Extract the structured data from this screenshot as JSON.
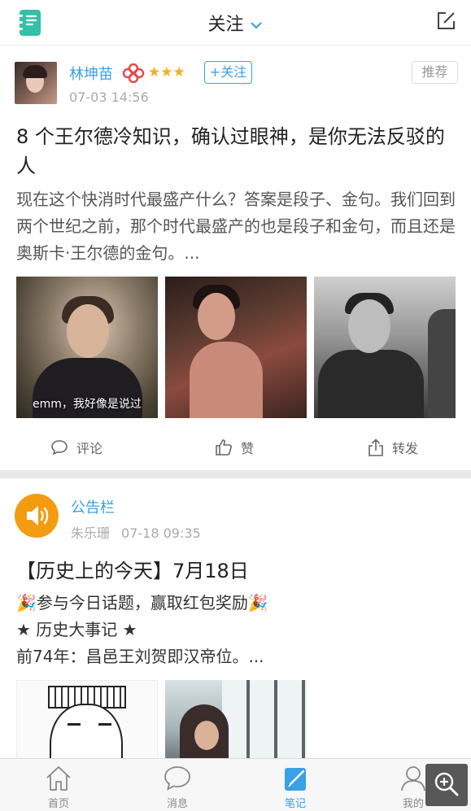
{
  "header": {
    "title": "关注",
    "logo_icon": "notebook-icon",
    "compose_icon": "edit-icon"
  },
  "post1": {
    "author": "林坤苗",
    "stars": "★★★",
    "rating_stars": 2.5,
    "follow_label": "+关注",
    "recommend_label": "推荐",
    "time": "07-03 14:56",
    "title": "8 个王尔德冷知识，确认过眼神，是你无法反驳的人",
    "excerpt": "现在这个快消时代最盛产什么？答案是段子、金句。我们回到两个世纪之前，那个时代最盛产的也是段子和金句，而且还是奥斯卡·王尔德的金句。...",
    "image_caption": "emm，我好像是说过",
    "actions": {
      "comment": "评论",
      "like": "赞",
      "share": "转发"
    }
  },
  "post2": {
    "author": "公告栏",
    "subauthor": "朱乐珊",
    "time": "07-18 09:35",
    "title": "【历史上的今天】7月18日",
    "line1": "🎉参与今日话题，赢取红包奖励🎉",
    "line2": "★ 历史大事记 ★",
    "line3": "前74年：昌邑王刘贺即汉帝位。..."
  },
  "tabbar": {
    "home": "首页",
    "messages": "消息",
    "notes": "笔记",
    "me": "我的"
  },
  "colors": {
    "accent": "#3aa0e8",
    "star": "#f2b01e",
    "announcement": "#f39c12"
  }
}
